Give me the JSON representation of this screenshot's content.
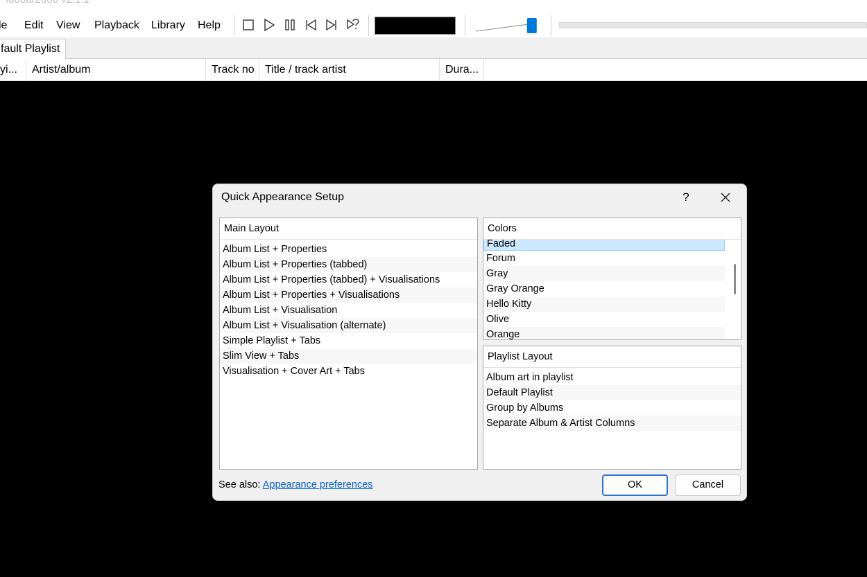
{
  "window": {
    "title": "foobar2000 v2.1.1"
  },
  "menubar": {
    "items": [
      "le",
      "Edit",
      "View",
      "Playback",
      "Library",
      "Help"
    ]
  },
  "toolbar": {
    "buttons": [
      "stop-icon",
      "play-icon",
      "pause-icon",
      "previous-icon",
      "next-icon",
      "random-icon"
    ],
    "volume_level": 0.9,
    "seek_position": 0.0
  },
  "playlist_tabs": [
    "fault Playlist"
  ],
  "columns": [
    "yi...",
    "Artist/album",
    "Track no",
    "Title / track artist",
    "Dura..."
  ],
  "dialog": {
    "title": "Quick Appearance Setup",
    "help_label": "?",
    "close_icon": "close-icon",
    "main_layout": {
      "header": "Main Layout",
      "items": [
        "Album List + Properties",
        "Album List + Properties (tabbed)",
        "Album List + Properties (tabbed) + Visualisations",
        "Album List + Properties + Visualisations",
        "Album List + Visualisation",
        "Album List + Visualisation (alternate)",
        "Simple Playlist + Tabs",
        "Slim View + Tabs",
        "Visualisation + Cover Art + Tabs"
      ]
    },
    "colors": {
      "header": "Colors",
      "selected": "Faded",
      "items": [
        "Faded",
        "Forum",
        "Gray",
        "Gray Orange",
        "Hello Kitty",
        "Olive",
        "Orange"
      ]
    },
    "playlist_layout": {
      "header": "Playlist Layout",
      "items": [
        "Album art in playlist",
        "Default Playlist",
        "Group by Albums",
        "Separate Album & Artist Columns"
      ]
    },
    "see_also_label": "See also:",
    "see_also_link": "Appearance preferences",
    "ok_label": "OK",
    "cancel_label": "Cancel"
  },
  "colors": {
    "accent": "#0078d7",
    "link": "#0a64c8",
    "selection": "#cce8ff"
  }
}
